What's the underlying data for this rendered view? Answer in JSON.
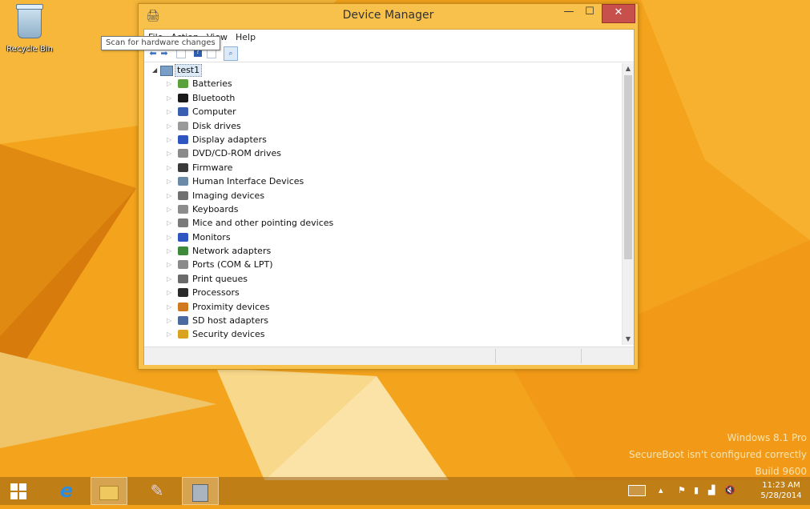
{
  "desktop": {
    "recycle_bin_label": "Recycle Bin",
    "watermark": {
      "line1": "Windows 8.1 Pro",
      "line2": "SecureBoot isn't configured correctly",
      "line3": "Build 9600"
    }
  },
  "window": {
    "title": "Device Manager",
    "menu": [
      "File",
      "Action",
      "View",
      "Help"
    ],
    "tooltip": "Scan for hardware changes",
    "root_node": "test1",
    "devices": [
      {
        "label": "Batteries",
        "icon": "battery-icon",
        "color": "#5aa13a"
      },
      {
        "label": "Bluetooth",
        "icon": "bluetooth-icon",
        "color": "#1a1a1a"
      },
      {
        "label": "Computer",
        "icon": "computer-icon",
        "color": "#3a5fb0"
      },
      {
        "label": "Disk drives",
        "icon": "disk-drive-icon",
        "color": "#9a9a9a"
      },
      {
        "label": "Display adapters",
        "icon": "display-adapter-icon",
        "color": "#2f55c0"
      },
      {
        "label": "DVD/CD-ROM drives",
        "icon": "dvd-drive-icon",
        "color": "#8a8a8a"
      },
      {
        "label": "Firmware",
        "icon": "firmware-icon",
        "color": "#3a3a3a"
      },
      {
        "label": "Human Interface Devices",
        "icon": "hid-icon",
        "color": "#6a8aa8"
      },
      {
        "label": "Imaging devices",
        "icon": "camera-icon",
        "color": "#707070"
      },
      {
        "label": "Keyboards",
        "icon": "keyboard-icon",
        "color": "#8c8c8c"
      },
      {
        "label": "Mice and other pointing devices",
        "icon": "mouse-icon",
        "color": "#7a7a7a"
      },
      {
        "label": "Monitors",
        "icon": "monitor-icon",
        "color": "#2f55c0"
      },
      {
        "label": "Network adapters",
        "icon": "network-icon",
        "color": "#3f8a3a"
      },
      {
        "label": "Ports (COM & LPT)",
        "icon": "port-icon",
        "color": "#8a8a8a"
      },
      {
        "label": "Print queues",
        "icon": "printer-icon",
        "color": "#6a6a6a"
      },
      {
        "label": "Processors",
        "icon": "processor-icon",
        "color": "#2a2a2a"
      },
      {
        "label": "Proximity devices",
        "icon": "proximity-icon",
        "color": "#d07a20"
      },
      {
        "label": "SD host adapters",
        "icon": "sd-card-icon",
        "color": "#4a6aa0"
      },
      {
        "label": "Security devices",
        "icon": "security-key-icon",
        "color": "#d9a320"
      }
    ]
  },
  "taskbar": {
    "clock_time": "11:23 AM",
    "clock_date": "5/28/2014"
  }
}
